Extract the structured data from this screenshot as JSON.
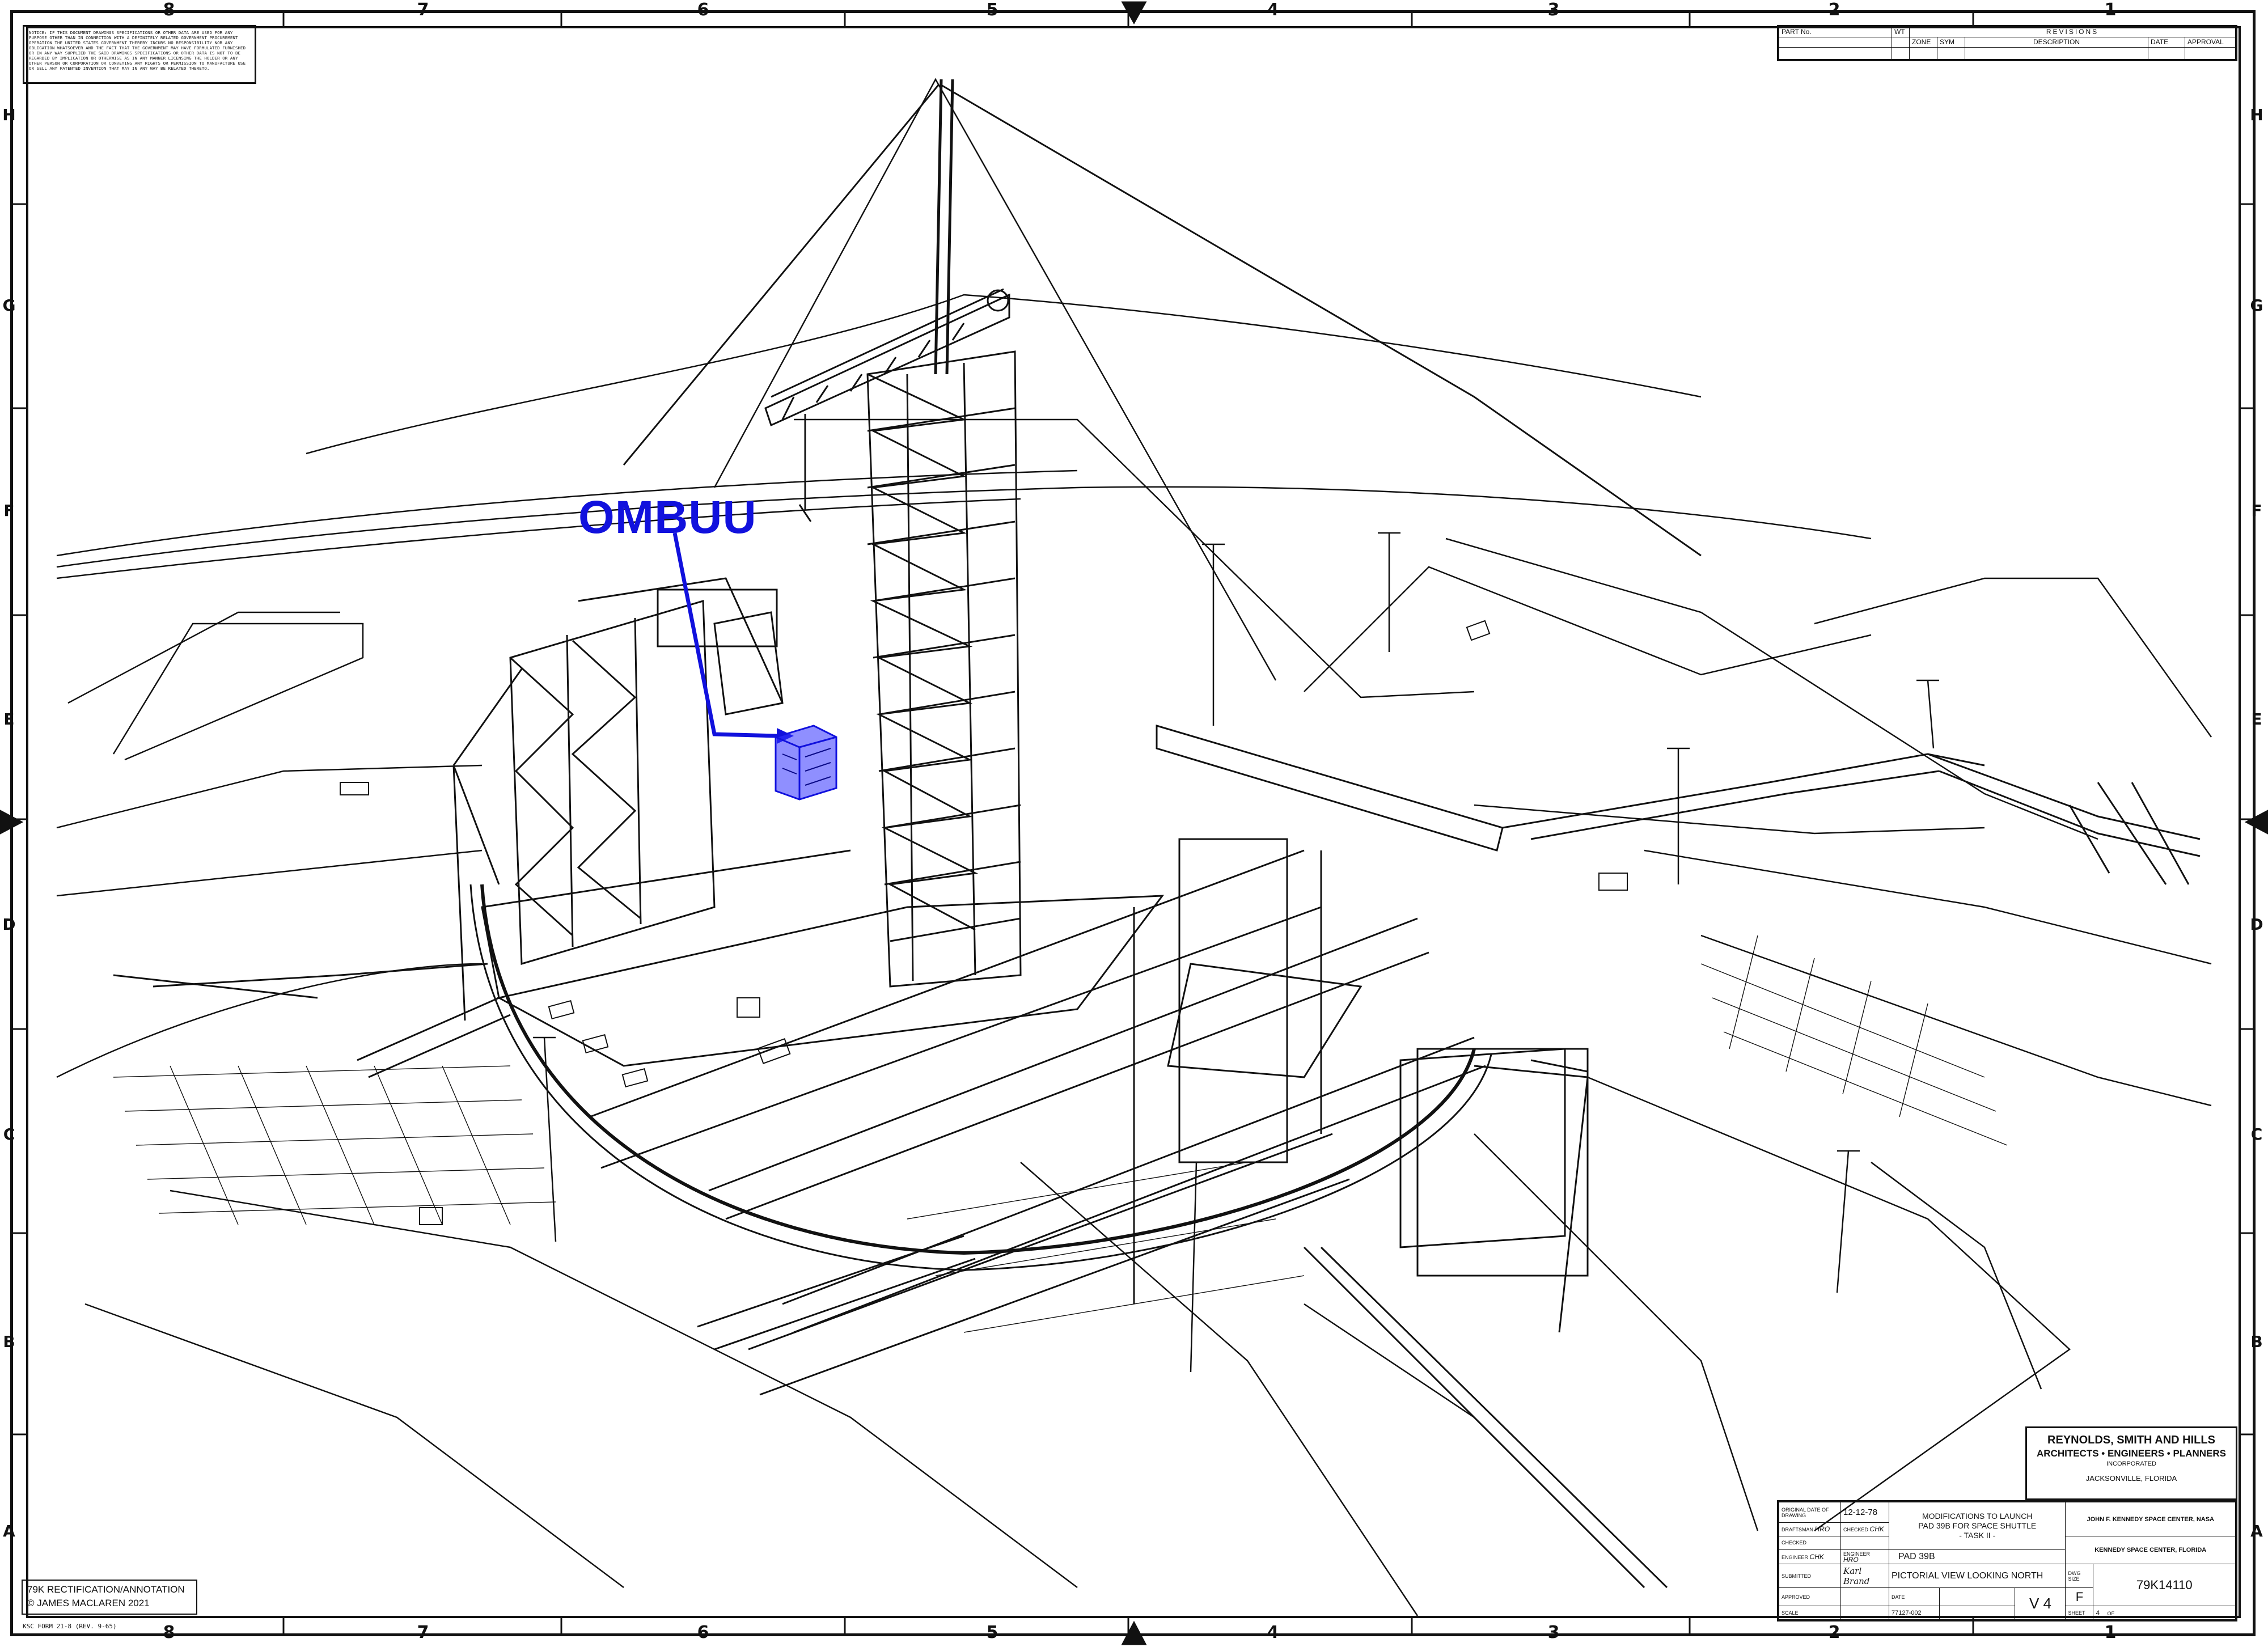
{
  "notice": {
    "text": "NOTICE: IF THIS DOCUMENT DRAWINGS SPECIFICATIONS OR OTHER DATA ARE USED FOR ANY PURPOSE OTHER THAN IN CONNECTION WITH A DEFINITELY RELATED GOVERNMENT PROCUREMENT OPERATION THE UNITED STATES GOVERNMENT THEREBY INCURS NO RESPONSIBILITY NOR ANY OBLIGATION WHATSOEVER AND THE FACT THAT THE GOVERNMENT MAY HAVE FORMULATED FURNISHED OR IN ANY WAY SUPPLIED THE SAID DRAWINGS SPECIFICATIONS OR OTHER DATA IS NOT TO BE REGARDED BY IMPLICATION OR OTHERWISE AS IN ANY MANNER LICENSING THE HOLDER OR ANY OTHER PERSON OR CORPORATION OR CONVEYING ANY RIGHTS OR PERMISSION TO MANUFACTURE USE OR SELL ANY PATENTED INVENTION THAT MAY IN ANY WAY BE RELATED THERETO."
  },
  "zones": {
    "columns": [
      "8",
      "7",
      "6",
      "5",
      "4",
      "3",
      "2",
      "1"
    ],
    "rows": [
      "H",
      "G",
      "F",
      "E",
      "D",
      "C",
      "B",
      "A"
    ]
  },
  "revisions": {
    "part_no_label": "PART No.",
    "wt_label": "WT",
    "title": "REVISIONS",
    "zone_label": "ZONE",
    "sym_label": "SYM",
    "description_label": "DESCRIPTION",
    "date_label": "DATE",
    "approval_label": "APPROVAL"
  },
  "annotation": {
    "label": "OMBUU",
    "color": "#1111dd"
  },
  "firm": {
    "name": "REYNOLDS, SMITH AND HILLS",
    "line2": "ARCHITECTS • ENGINEERS • PLANNERS",
    "line3": "INCORPORATED",
    "city": "JACKSONVILLE, FLORIDA"
  },
  "title_block": {
    "original_date_label": "ORIGINAL DATE OF DRAWING",
    "original_date": "12-12-78",
    "draftsman_label": "DRAFTSMAN",
    "draftsman": "HRO",
    "checked_label": "CHECKED",
    "checked": "CHK",
    "checked2_label": "CHECKED",
    "engineer_label": "ENGINEER",
    "engineer": "CHK",
    "engineer2_label": "ENGINEER",
    "engineer2": "HRO",
    "submitted_label": "SUBMITTED",
    "submitted": "Karl Brand",
    "approved_label": "APPROVED",
    "title1": "MODIFICATIONS TO LAUNCH",
    "title2": "PAD 39B FOR SPACE SHUTTLE",
    "title3": "- TASK II -",
    "agency1": "JOHN F. KENNEDY SPACE CENTER, NASA",
    "agency2": "KENNEDY SPACE CENTER, FLORIDA",
    "pad": "PAD 39B",
    "view": "PICTORIAL VIEW LOOKING NORTH",
    "sheet_code": "V 4",
    "dwg_size_label": "DWG SIZE",
    "dwg_size": "F",
    "dwg_no": "79K14110",
    "scale_label": "SCALE",
    "date_label": "DATE",
    "code": "77127-002",
    "sheet_label": "SHEET",
    "sheet": "4",
    "of_label": "OF"
  },
  "credit": {
    "line1": "79K RECTIFICATION/ANNOTATION",
    "line2": "© JAMES MACLAREN 2021"
  },
  "form_no": "KSC FORM 21-8 (REV. 9-65)"
}
